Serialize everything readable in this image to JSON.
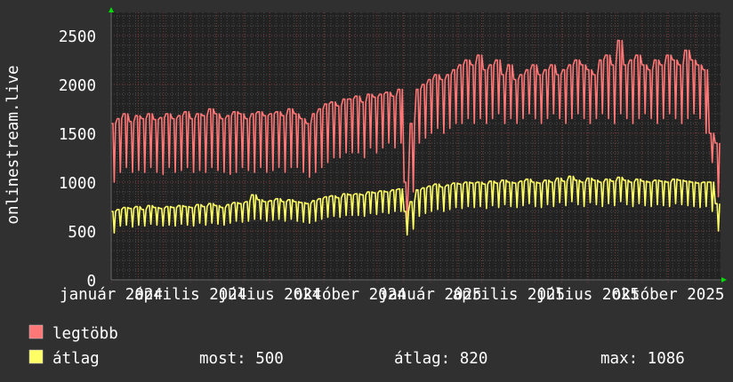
{
  "chart_data": {
    "type": "line",
    "ylabel": "onlinestream.live",
    "ylim": [
      0,
      2700
    ],
    "yticks": [
      0,
      500,
      1000,
      1500,
      2000,
      2500
    ],
    "x_start": "2024-01-01",
    "x_end": "2025-11-30",
    "xtick_labels": [
      "január 2024",
      "április 2024",
      "július 2024",
      "október 2024",
      "január 2025",
      "április 2025",
      "július 2025",
      "október 2025"
    ],
    "xtick_dates": [
      "2024-01-01",
      "2024-04-01",
      "2024-07-01",
      "2024-10-01",
      "2025-01-01",
      "2025-04-01",
      "2025-07-01",
      "2025-10-01"
    ],
    "grid": true,
    "background": "#222222",
    "sampling": "weekly high / low",
    "series": [
      {
        "name": "legtöbb",
        "color": "#ff7777",
        "weekly_high": [
          1600,
          1650,
          1700,
          1620,
          1680,
          1650,
          1700,
          1640,
          1660,
          1700,
          1650,
          1680,
          1720,
          1650,
          1700,
          1680,
          1750,
          1700,
          1650,
          1680,
          1720,
          1700,
          1650,
          1700,
          1720,
          1680,
          1700,
          1720,
          1680,
          1750,
          1700,
          1650,
          1600,
          1700,
          1750,
          1800,
          1820,
          1780,
          1850,
          1850,
          1880,
          1820,
          1900,
          1870,
          1900,
          1920,
          1880,
          1950,
          1000,
          1600,
          1950,
          2000,
          2050,
          2100,
          2050,
          2100,
          2150,
          2200,
          2250,
          2200,
          2300,
          2150,
          2200,
          2250,
          2100,
          2200,
          2050,
          2100,
          2150,
          2200,
          2100,
          2150,
          2200,
          2100,
          2150,
          2200,
          2250,
          2200,
          2150,
          2100,
          2250,
          2300,
          2200,
          2450,
          2200,
          2250,
          2300,
          2200,
          2150,
          2250,
          2200,
          2300,
          2250,
          2200,
          2350,
          2250,
          2200,
          2150,
          1500,
          1400
        ],
        "weekly_low": [
          1000,
          1100,
          1150,
          1100,
          1120,
          1100,
          1150,
          1100,
          1080,
          1150,
          1100,
          1120,
          1150,
          1100,
          1120,
          1100,
          1150,
          1120,
          1100,
          1080,
          1100,
          1150,
          1120,
          1100,
          1150,
          1100,
          1120,
          1150,
          1100,
          1150,
          1150,
          1100,
          1050,
          1100,
          1150,
          1200,
          1250,
          1250,
          1300,
          1300,
          1300,
          1250,
          1350,
          1300,
          1350,
          1400,
          1350,
          1400,
          600,
          900,
          1400,
          1450,
          1500,
          1550,
          1500,
          1550,
          1600,
          1600,
          1650,
          1600,
          1650,
          1600,
          1650,
          1700,
          1600,
          1650,
          1600,
          1650,
          1700,
          1650,
          1600,
          1650,
          1700,
          1650,
          1600,
          1650,
          1700,
          1650,
          1600,
          1650,
          1700,
          1650,
          1600,
          1700,
          1650,
          1600,
          1650,
          1700,
          1650,
          1600,
          1650,
          1700,
          1650,
          1600,
          1650,
          1700,
          1650,
          1500,
          1200,
          850
        ]
      },
      {
        "name": "átlag",
        "color": "#ffff66",
        "weekly_high": [
          700,
          720,
          740,
          730,
          750,
          720,
          760,
          740,
          730,
          750,
          740,
          760,
          750,
          740,
          770,
          750,
          780,
          760,
          740,
          770,
          790,
          780,
          800,
          870,
          820,
          800,
          810,
          830,
          800,
          820,
          800,
          790,
          780,
          810,
          830,
          850,
          860,
          840,
          880,
          870,
          880,
          870,
          900,
          890,
          910,
          900,
          920,
          930,
          700,
          800,
          920,
          940,
          960,
          980,
          950,
          970,
          990,
          980,
          1000,
          990,
          1000,
          980,
          1010,
          990,
          1020,
          1000,
          990,
          1010,
          1030,
          1000,
          990,
          1020,
          1000,
          1040,
          1010,
          1060,
          1020,
          1000,
          1040,
          1020,
          1000,
          1030,
          1010,
          1050,
          1020,
          1000,
          1030,
          1010,
          1000,
          1020,
          1010,
          1000,
          1030,
          1020,
          1010,
          1000,
          990,
          1000,
          1000,
          780
        ],
        "weekly_low": [
          480,
          550,
          560,
          540,
          560,
          550,
          570,
          560,
          550,
          560,
          550,
          570,
          560,
          550,
          580,
          560,
          580,
          570,
          560,
          580,
          600,
          590,
          600,
          620,
          620,
          600,
          610,
          620,
          600,
          620,
          600,
          590,
          580,
          600,
          620,
          640,
          650,
          640,
          660,
          660,
          660,
          650,
          680,
          670,
          690,
          680,
          700,
          700,
          460,
          520,
          650,
          680,
          700,
          720,
          700,
          720,
          740,
          730,
          750,
          740,
          750,
          730,
          760,
          740,
          770,
          750,
          740,
          760,
          780,
          750,
          740,
          770,
          750,
          790,
          760,
          800,
          770,
          750,
          790,
          770,
          750,
          780,
          760,
          800,
          770,
          750,
          780,
          760,
          750,
          770,
          760,
          750,
          780,
          770,
          760,
          750,
          740,
          750,
          700,
          500
        ]
      }
    ]
  },
  "legend": {
    "max_label": "legtöbb",
    "avg_label": "átlag",
    "now_text": "most: 500",
    "avg_text": "átlag: 820",
    "max_text": "max: 1086"
  }
}
